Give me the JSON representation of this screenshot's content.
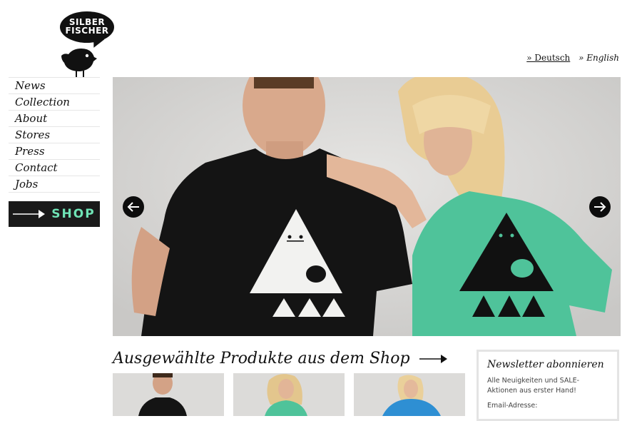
{
  "logo": {
    "line1": "SILBER",
    "line2": "FISCHER"
  },
  "language": {
    "german": "» Deutsch",
    "english": "» English"
  },
  "nav": {
    "items": [
      {
        "label": "News"
      },
      {
        "label": "Collection"
      },
      {
        "label": "About"
      },
      {
        "label": "Stores"
      },
      {
        "label": "Press"
      },
      {
        "label": "Contact"
      },
      {
        "label": "Jobs"
      }
    ],
    "shop_label": "SHOP"
  },
  "hero": {
    "prev_icon": "arrow-left-icon",
    "next_icon": "arrow-right-icon",
    "colors": {
      "shirt_black": "#141414",
      "shirt_green": "#4fc39a"
    }
  },
  "featured": {
    "title": "Ausgewählte Produkte aus dem Shop"
  },
  "newsletter": {
    "title": "Newsletter abonnieren",
    "text": "Alle Neuigkeiten und SALE-Aktionen aus erster Hand!",
    "email_label": "Email-Adresse:"
  },
  "colors": {
    "shop_accent": "#6fe3b5",
    "shop_bg": "#1a1a1a"
  }
}
